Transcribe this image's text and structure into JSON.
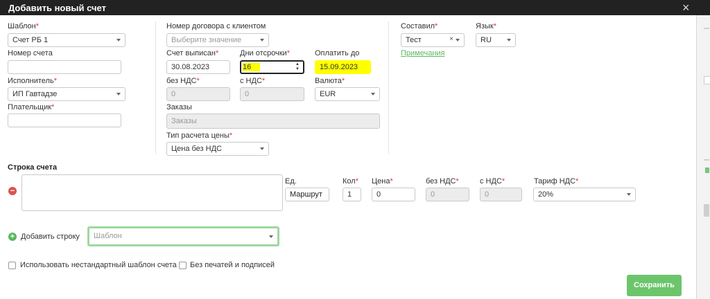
{
  "window": {
    "title": "Добавить новый счет",
    "close_icon": "×"
  },
  "fields": {
    "template": {
      "label": "Шаблон",
      "value": "Счет РБ 1"
    },
    "invoice_number": {
      "label": "Номер счета",
      "value": ""
    },
    "executor": {
      "label": "Исполнитель",
      "value": "ИП Гавтадзе"
    },
    "payer": {
      "label": "Плательщик",
      "value": ""
    },
    "contract_number": {
      "label": "Номер договора с клиентом",
      "placeholder": "Выберите значение"
    },
    "issued": {
      "label": "Счет выписан",
      "value": "30.08.2023"
    },
    "deferral_days": {
      "label": "Дни отсрочки",
      "value": "16"
    },
    "pay_by": {
      "label": "Оплатить до",
      "value": "15.09.2023"
    },
    "without_vat": {
      "label": "без НДС",
      "value": "0"
    },
    "with_vat": {
      "label": "с НДС",
      "value": "0"
    },
    "currency": {
      "label": "Валюта",
      "value": "EUR"
    },
    "orders": {
      "label": "Заказы",
      "placeholder": "Заказы"
    },
    "price_type": {
      "label": "Тип расчета цены",
      "value": "Цена без НДС"
    },
    "compiled_by": {
      "label": "Составил",
      "value": "Тест"
    },
    "language": {
      "label": "Язык",
      "value": "RU"
    },
    "notes_link": "Примечания"
  },
  "line_section": {
    "title": "Строка счета",
    "unit": {
      "label": "Ед.",
      "value": "Маршрут"
    },
    "qty": {
      "label": "Кол",
      "value": "1"
    },
    "price": {
      "label": "Цена",
      "value": "0"
    },
    "without_vat": {
      "label": "без НДС",
      "value": "0"
    },
    "with_vat": {
      "label": "с НДС",
      "value": "0"
    },
    "vat_rate": {
      "label": "Тариф НДС",
      "value": "20%"
    }
  },
  "add_row": {
    "label": "Добавить строку",
    "template_placeholder": "Шаблон"
  },
  "options": {
    "custom_template": "Использовать нестандартный шаблон счета",
    "no_stamps": "Без печатей и подписей"
  },
  "save_button": "Сохранить",
  "required_mark": "*",
  "colors": {
    "accent": "#6cc56b",
    "highlight": "#ffff00",
    "required": "#e3342f",
    "titlebar": "#222222"
  }
}
